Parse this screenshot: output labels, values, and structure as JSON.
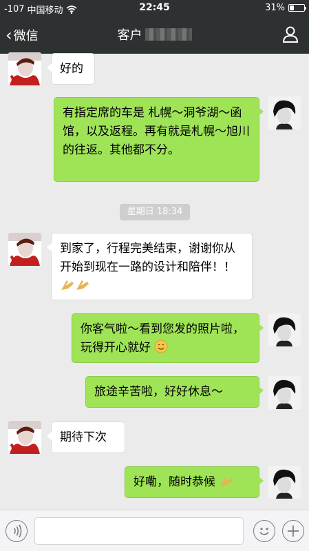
{
  "status_bar": {
    "signal": "-107",
    "carrier": "中国移动",
    "time": "22:45",
    "battery": "31%",
    "battery_level": 0.31
  },
  "nav": {
    "back_label": "微信",
    "title": "客户"
  },
  "messages": [
    {
      "side": "in",
      "text": "好的"
    },
    {
      "side": "out",
      "text": "有指定席的车是 札幌～洞爷湖～函馆，以及返程。再有就是札幌～旭川的往返。其他都不分。"
    },
    {
      "side": "in",
      "text": "到家了，行程完美结束，谢谢你从开始到现在一路的设计和陪伴！！"
    },
    {
      "side": "out",
      "text": "你客气啦～看到您发的照片啦，玩得开心就好"
    },
    {
      "side": "out",
      "text": "旅途辛苦啦，好好休息～"
    },
    {
      "side": "in",
      "text": "期待下次"
    },
    {
      "side": "out",
      "text": "好嘞，随时恭候"
    }
  ],
  "timestamp": "星期日 18:34",
  "icons": [
    "wifi-icon",
    "back-chevron-icon",
    "person-icon",
    "voice-icon",
    "emoji-icon",
    "plus-icon",
    "clap-icon",
    "smile-icon"
  ],
  "colors": {
    "nav_bg": "#2e3132",
    "chat_bg": "#ebebeb",
    "bubble_out": "#9fe457",
    "bubble_in": "#ffffff"
  }
}
